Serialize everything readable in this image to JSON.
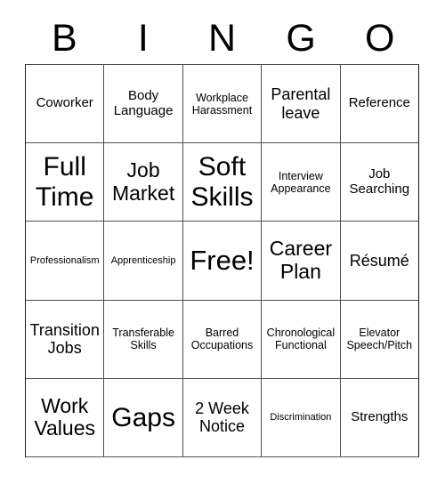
{
  "card": {
    "title": "BINGO",
    "header_letters": [
      "B",
      "I",
      "N",
      "G",
      "O"
    ],
    "background_color": "#ffffff",
    "border_color": "#4d4d4d",
    "text_color": "#000000",
    "rows": 5,
    "columns": 5,
    "free_space": "Free!",
    "cells": [
      [
        {
          "text": "Coworker",
          "size": "md"
        },
        {
          "text": "Body\nLanguage",
          "size": "md"
        },
        {
          "text": "Workplace\nHarassment",
          "size": "sm"
        },
        {
          "text": "Parental\nleave",
          "size": "lg"
        },
        {
          "text": "Reference",
          "size": "md"
        }
      ],
      [
        {
          "text": "Full\nTime",
          "size": "xxl"
        },
        {
          "text": "Job\nMarket",
          "size": "xl"
        },
        {
          "text": "Soft\nSkills",
          "size": "xxl"
        },
        {
          "text": "Interview\nAppearance",
          "size": "sm"
        },
        {
          "text": "Job\nSearching",
          "size": "md"
        }
      ],
      [
        {
          "text": "Professionalism",
          "size": "xs"
        },
        {
          "text": "Apprenticeship",
          "size": "xs"
        },
        {
          "text": "Free!",
          "size": "free"
        },
        {
          "text": "Career\nPlan",
          "size": "xl"
        },
        {
          "text": "Résumé",
          "size": "lg"
        }
      ],
      [
        {
          "text": "Transition\nJobs",
          "size": "lg"
        },
        {
          "text": "Transferable\nSkills",
          "size": "sm"
        },
        {
          "text": "Barred\nOccupations",
          "size": "sm"
        },
        {
          "text": "Chronological\nFunctional",
          "size": "sm"
        },
        {
          "text": "Elevator\nSpeech/Pitch",
          "size": "sm"
        }
      ],
      [
        {
          "text": "Work\nValues",
          "size": "xl"
        },
        {
          "text": "Gaps",
          "size": "xxl"
        },
        {
          "text": "2 Week\nNotice",
          "size": "lg"
        },
        {
          "text": "Discrimination",
          "size": "xs"
        },
        {
          "text": "Strengths",
          "size": "md"
        }
      ]
    ]
  }
}
